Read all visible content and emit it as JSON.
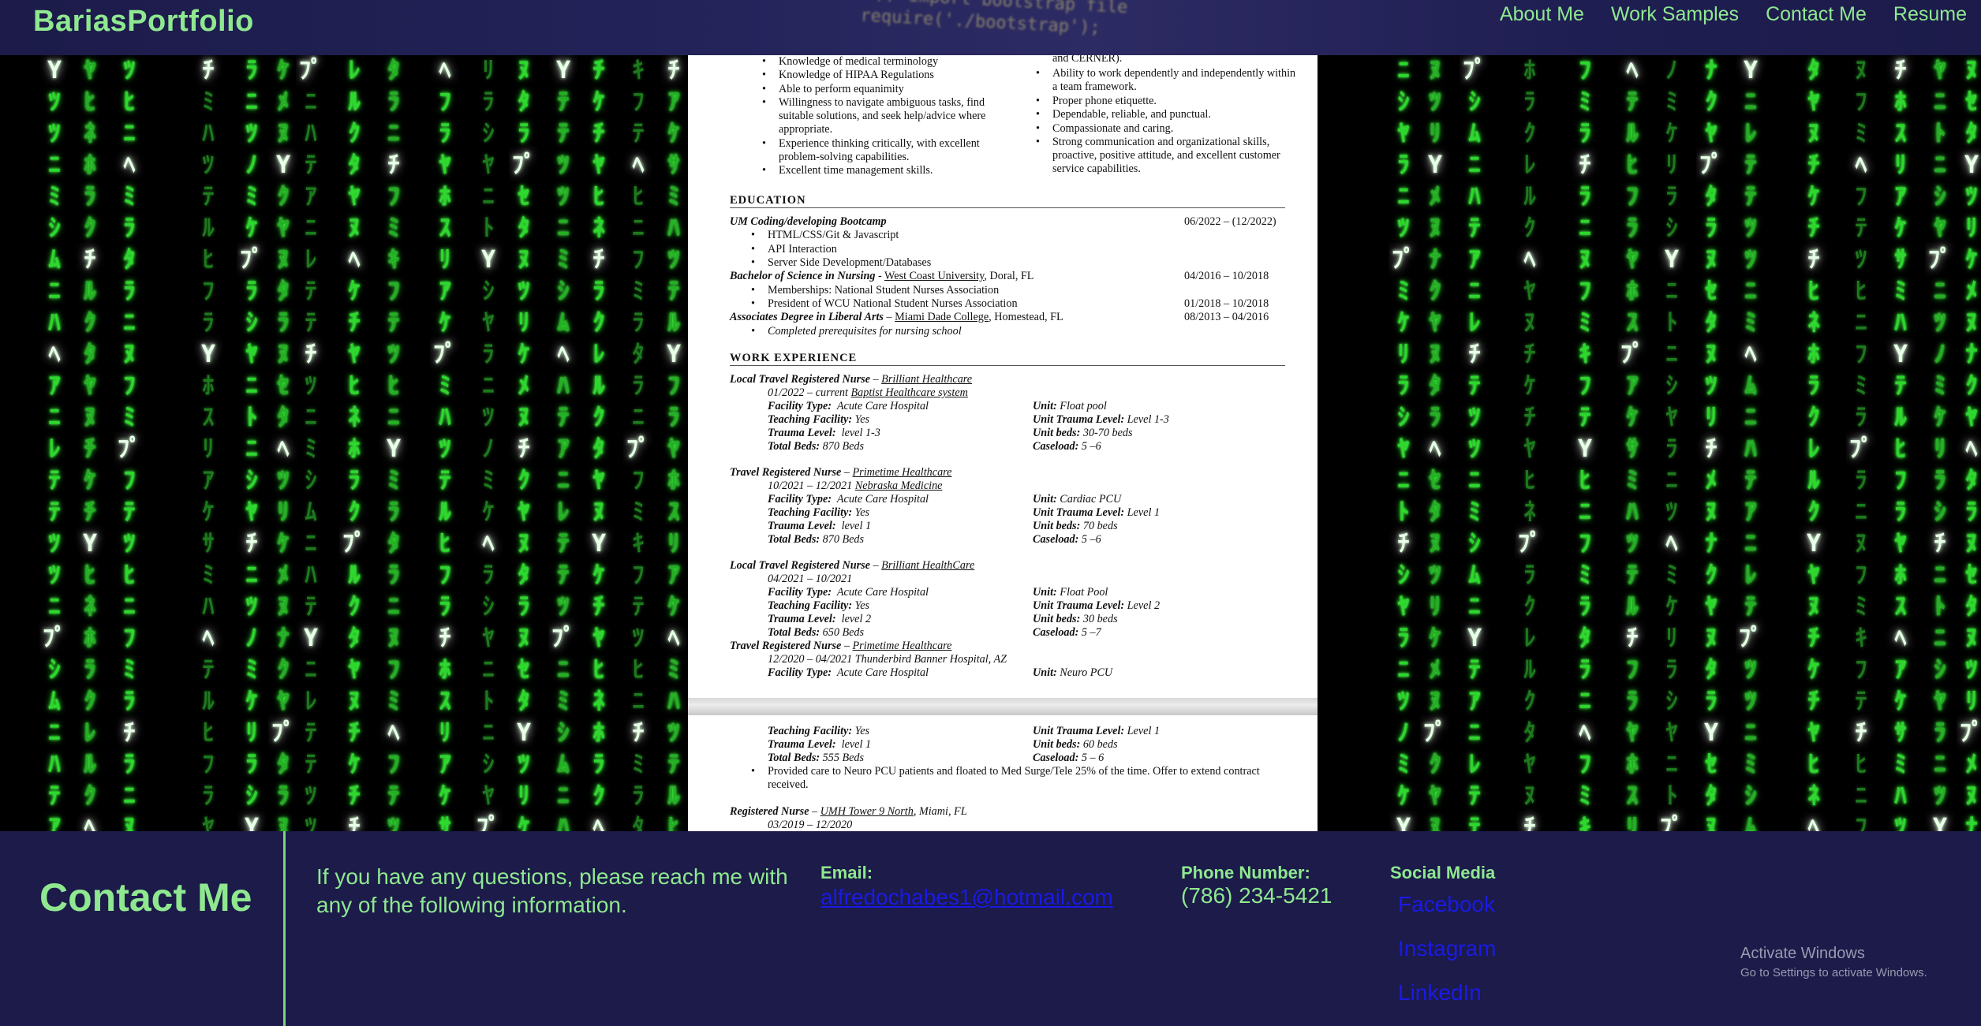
{
  "header": {
    "brand": "BariasPortfolio",
    "code_overlay": [
      "// import bootstrap file",
      "require('./bootstrap');"
    ],
    "nav": [
      "About Me",
      "Work Samples",
      "Contact Me",
      "Resume"
    ]
  },
  "matrix": {
    "columns": [
      "ﾃﾂﾂﾆﾐｼﾑﾆﾊﾃｱﾆﾚﾃ",
      "ﾁﾔﾋﾈﾎﾗｸﾚﾙｸﾀﾔﾇﾁｹ",
      "ﾌﾃﾂﾋﾆﾌﾐﾗﾀﾗﾆﾇﾌﾐｷ",
      "ﾘｱｹｻﾐﾊﾂﾃﾙﾋﾌﾗﾔﾎｽ",
      "ﾄﾆｼﾔﾗﾆﾂﾉﾐｹﾘﾗｼﾔﾆ",
      "ｾﾀﾇﾂﾘｹﾒﾇﾅｸﾔﾇﾀﾗﾇ"
    ],
    "white_glyphs": [
      "Y",
      "ﾍ",
      "ﾌﾟ",
      "ﾁ"
    ]
  },
  "resume": {
    "skills_left": [
      "Knowledge of medical terminology",
      "Knowledge of HIPAA Regulations",
      "Able to perform equanimity",
      "Willingness to navigate ambiguous tasks, find",
      "suitable solutions, and seek help/advice where",
      "appropriate.",
      "Experience thinking critically, with excellent",
      "problem-solving capabilities.",
      "Excellent time management skills."
    ],
    "skills_right": [
      "and CERNER).",
      "Ability to work dependently and independently within",
      "a team framework.",
      "Proper phone etiquette.",
      "Dependable, reliable, and punctual.",
      "Compassionate and caring.",
      "Strong communication and organizational skills,",
      "proactive, positive attitude, and excellent customer",
      "service capabilities."
    ],
    "education_title": "EDUCATION",
    "edu1_school": "UM Coding/developing Bootcamp",
    "edu1_dates": "06/2022 – (12/2022)",
    "edu1_items": [
      "HTML/CSS/Git & Javascript",
      "API Interaction",
      "Server Side Development/Databases"
    ],
    "edu2_degree": "Bachelor of Science in Nursing",
    "edu2_sep": " - ",
    "edu2_school": "West Coast University",
    "edu2_loc": ", Doral, FL",
    "edu2_dates": "04/2016 – 10/2018",
    "edu2_items": [
      "Memberships: National Student Nurses Association",
      "President of WCU National Student Nurses Association"
    ],
    "edu2_pres_dates": "01/2018 – 10/2018",
    "edu3_degree": "Associates Degree in Liberal Arts",
    "edu3_sep": " – ",
    "edu3_school": "Miami Dade College",
    "edu3_loc": ", Homestead, FL",
    "edu3_dates": "08/2013 – 04/2016",
    "edu3_item": "Completed prerequisites for nursing school",
    "work_title": "WORK EXPERIENCE",
    "labels": {
      "facility_type": "Facility Type:",
      "teaching": "Teaching Facility:",
      "trauma": "Trauma Level:",
      "beds": "Total Beds:",
      "unit": "Unit:",
      "unit_trauma": "Unit Trauma Level:",
      "unit_beds": "Unit beds:",
      "caseload": "Caseload:"
    },
    "jobs": [
      {
        "title": "Local Travel Registered Nurse",
        "sep": " – ",
        "company": "Brilliant Healthcare",
        "dates": "01/2022 – current",
        "facility": "Baptist Healthcare system",
        "facility_type": "Acute Care Hospital",
        "teaching": "Yes",
        "trauma": "level 1-3",
        "beds": "870 Beds",
        "unit": "Float pool",
        "unit_trauma": "Level 1-3",
        "unit_beds": "30-70 beds",
        "caseload": "5 –6"
      },
      {
        "title": "Travel Registered Nurse",
        "sep": " – ",
        "company": "Primetime Healthcare",
        "dates": "10/2021 – 12/2021",
        "facility": "Nebraska Medicine",
        "facility_type": "Acute Care Hospital",
        "teaching": "Yes",
        "trauma": "level 1",
        "beds": "870 Beds",
        "unit": "Cardiac PCU",
        "unit_trauma": "Level 1",
        "unit_beds": "70 beds",
        "caseload": "5 –6"
      },
      {
        "title": "Local Travel Registered Nurse",
        "sep": " – ",
        "company": "Brilliant HealthCare",
        "dates": "04/2021 – 10/2021",
        "facility_type": "Acute Care Hospital",
        "teaching": "Yes",
        "trauma": "level 2",
        "beds": "650 Beds",
        "unit": "Float Pool",
        "unit_trauma": "Level 2",
        "unit_beds": "30 beds",
        "caseload": "5 –7"
      },
      {
        "title": "Travel Registered Nurse",
        "sep": " – ",
        "company": "Primetime Healthcare",
        "dates": "12/2020 – 04/2021 Thunderbird Banner Hospital, AZ",
        "facility_type": "Acute Care Hospital",
        "unit": "Neuro PCU"
      }
    ],
    "page2": {
      "teaching": "Yes",
      "trauma": "level 1",
      "beds": "555 Beds",
      "unit_trauma": "Level 1",
      "unit_beds": "60 beds",
      "caseload": "5 – 6",
      "bullet1": "Provided care to Neuro PCU patients and floated to Med Surge/Tele 25% of the time. Offer to extend contract",
      "bullet2": "received.",
      "job_title": "Registered Nurse",
      "job_sep": " – ",
      "job_company": "UMH Tower 9 North",
      "job_loc": ", Miami, FL",
      "job_dates": "03/2019 – 12/2020"
    }
  },
  "footer": {
    "title": "Contact Me",
    "intro": "If you have any questions, please reach me with any of the following information.",
    "email_label": "Email:",
    "email": "alfredochabes1@hotmail.com",
    "phone_label": "Phone Number:",
    "phone": "(786) 234-5421",
    "social_label": "Social Media",
    "social": [
      "Facebook",
      "Instagram",
      "LinkedIn"
    ]
  },
  "watermark": {
    "line1": "Activate Windows",
    "line2": "Go to Settings to activate Windows."
  },
  "colors": {
    "brand_green": "#8fe88f",
    "navy": "#1c1b4a",
    "link_blue": "#1a1ae6",
    "matrix_green": "#2cd92c"
  }
}
